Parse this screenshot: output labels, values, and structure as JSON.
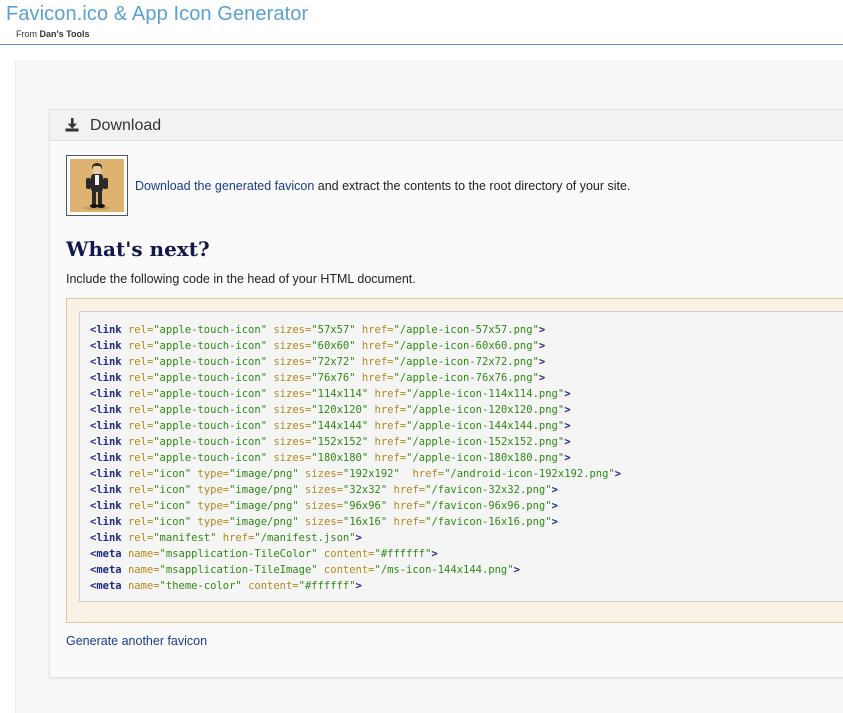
{
  "header": {
    "title": "Favicon.ico & App Icon Generator",
    "from_prefix": "From ",
    "from_name": "Dan's Tools"
  },
  "download_panel": {
    "title": "Download",
    "link_text": "Download the generated favicon",
    "after_link": " and extract the contents to the root directory of your site."
  },
  "whats_next": {
    "heading": "What's next?",
    "instruction": "Include the following code in the head of your HTML document."
  },
  "code_lines": [
    {
      "tag": "link",
      "attrs": [
        [
          "rel",
          "apple-touch-icon"
        ],
        [
          "sizes",
          "57x57"
        ],
        [
          "href",
          "/apple-icon-57x57.png"
        ]
      ]
    },
    {
      "tag": "link",
      "attrs": [
        [
          "rel",
          "apple-touch-icon"
        ],
        [
          "sizes",
          "60x60"
        ],
        [
          "href",
          "/apple-icon-60x60.png"
        ]
      ]
    },
    {
      "tag": "link",
      "attrs": [
        [
          "rel",
          "apple-touch-icon"
        ],
        [
          "sizes",
          "72x72"
        ],
        [
          "href",
          "/apple-icon-72x72.png"
        ]
      ]
    },
    {
      "tag": "link",
      "attrs": [
        [
          "rel",
          "apple-touch-icon"
        ],
        [
          "sizes",
          "76x76"
        ],
        [
          "href",
          "/apple-icon-76x76.png"
        ]
      ]
    },
    {
      "tag": "link",
      "attrs": [
        [
          "rel",
          "apple-touch-icon"
        ],
        [
          "sizes",
          "114x114"
        ],
        [
          "href",
          "/apple-icon-114x114.png"
        ]
      ]
    },
    {
      "tag": "link",
      "attrs": [
        [
          "rel",
          "apple-touch-icon"
        ],
        [
          "sizes",
          "120x120"
        ],
        [
          "href",
          "/apple-icon-120x120.png"
        ]
      ]
    },
    {
      "tag": "link",
      "attrs": [
        [
          "rel",
          "apple-touch-icon"
        ],
        [
          "sizes",
          "144x144"
        ],
        [
          "href",
          "/apple-icon-144x144.png"
        ]
      ]
    },
    {
      "tag": "link",
      "attrs": [
        [
          "rel",
          "apple-touch-icon"
        ],
        [
          "sizes",
          "152x152"
        ],
        [
          "href",
          "/apple-icon-152x152.png"
        ]
      ]
    },
    {
      "tag": "link",
      "attrs": [
        [
          "rel",
          "apple-touch-icon"
        ],
        [
          "sizes",
          "180x180"
        ],
        [
          "href",
          "/apple-icon-180x180.png"
        ]
      ]
    },
    {
      "tag": "link",
      "attrs": [
        [
          "rel",
          "icon"
        ],
        [
          "type",
          "image/png"
        ],
        [
          "sizes",
          "192x192"
        ],
        [
          "href",
          "/android-icon-192x192.png"
        ]
      ],
      "extra_space_before_last": true
    },
    {
      "tag": "link",
      "attrs": [
        [
          "rel",
          "icon"
        ],
        [
          "type",
          "image/png"
        ],
        [
          "sizes",
          "32x32"
        ],
        [
          "href",
          "/favicon-32x32.png"
        ]
      ]
    },
    {
      "tag": "link",
      "attrs": [
        [
          "rel",
          "icon"
        ],
        [
          "type",
          "image/png"
        ],
        [
          "sizes",
          "96x96"
        ],
        [
          "href",
          "/favicon-96x96.png"
        ]
      ]
    },
    {
      "tag": "link",
      "attrs": [
        [
          "rel",
          "icon"
        ],
        [
          "type",
          "image/png"
        ],
        [
          "sizes",
          "16x16"
        ],
        [
          "href",
          "/favicon-16x16.png"
        ]
      ]
    },
    {
      "tag": "link",
      "attrs": [
        [
          "rel",
          "manifest"
        ],
        [
          "href",
          "/manifest.json"
        ]
      ]
    },
    {
      "tag": "meta",
      "attrs": [
        [
          "name",
          "msapplication-TileColor"
        ],
        [
          "content",
          "#ffffff"
        ]
      ]
    },
    {
      "tag": "meta",
      "attrs": [
        [
          "name",
          "msapplication-TileImage"
        ],
        [
          "content",
          "/ms-icon-144x144.png"
        ]
      ]
    },
    {
      "tag": "meta",
      "attrs": [
        [
          "name",
          "theme-color"
        ],
        [
          "content",
          "#ffffff"
        ]
      ]
    }
  ],
  "footer_link": "Generate another favicon",
  "colors": {
    "header_title": "#5aa0d6",
    "heading_navy": "#12174f",
    "link_blue": "#1a3a8f",
    "code_tag": "#1d2a84",
    "code_attr": "#b08a1a",
    "code_value": "#2f8a12",
    "thumb_bg": "#deb271"
  },
  "icons": {
    "download": "download-icon",
    "thumbnail": "favicon-preview-image"
  }
}
